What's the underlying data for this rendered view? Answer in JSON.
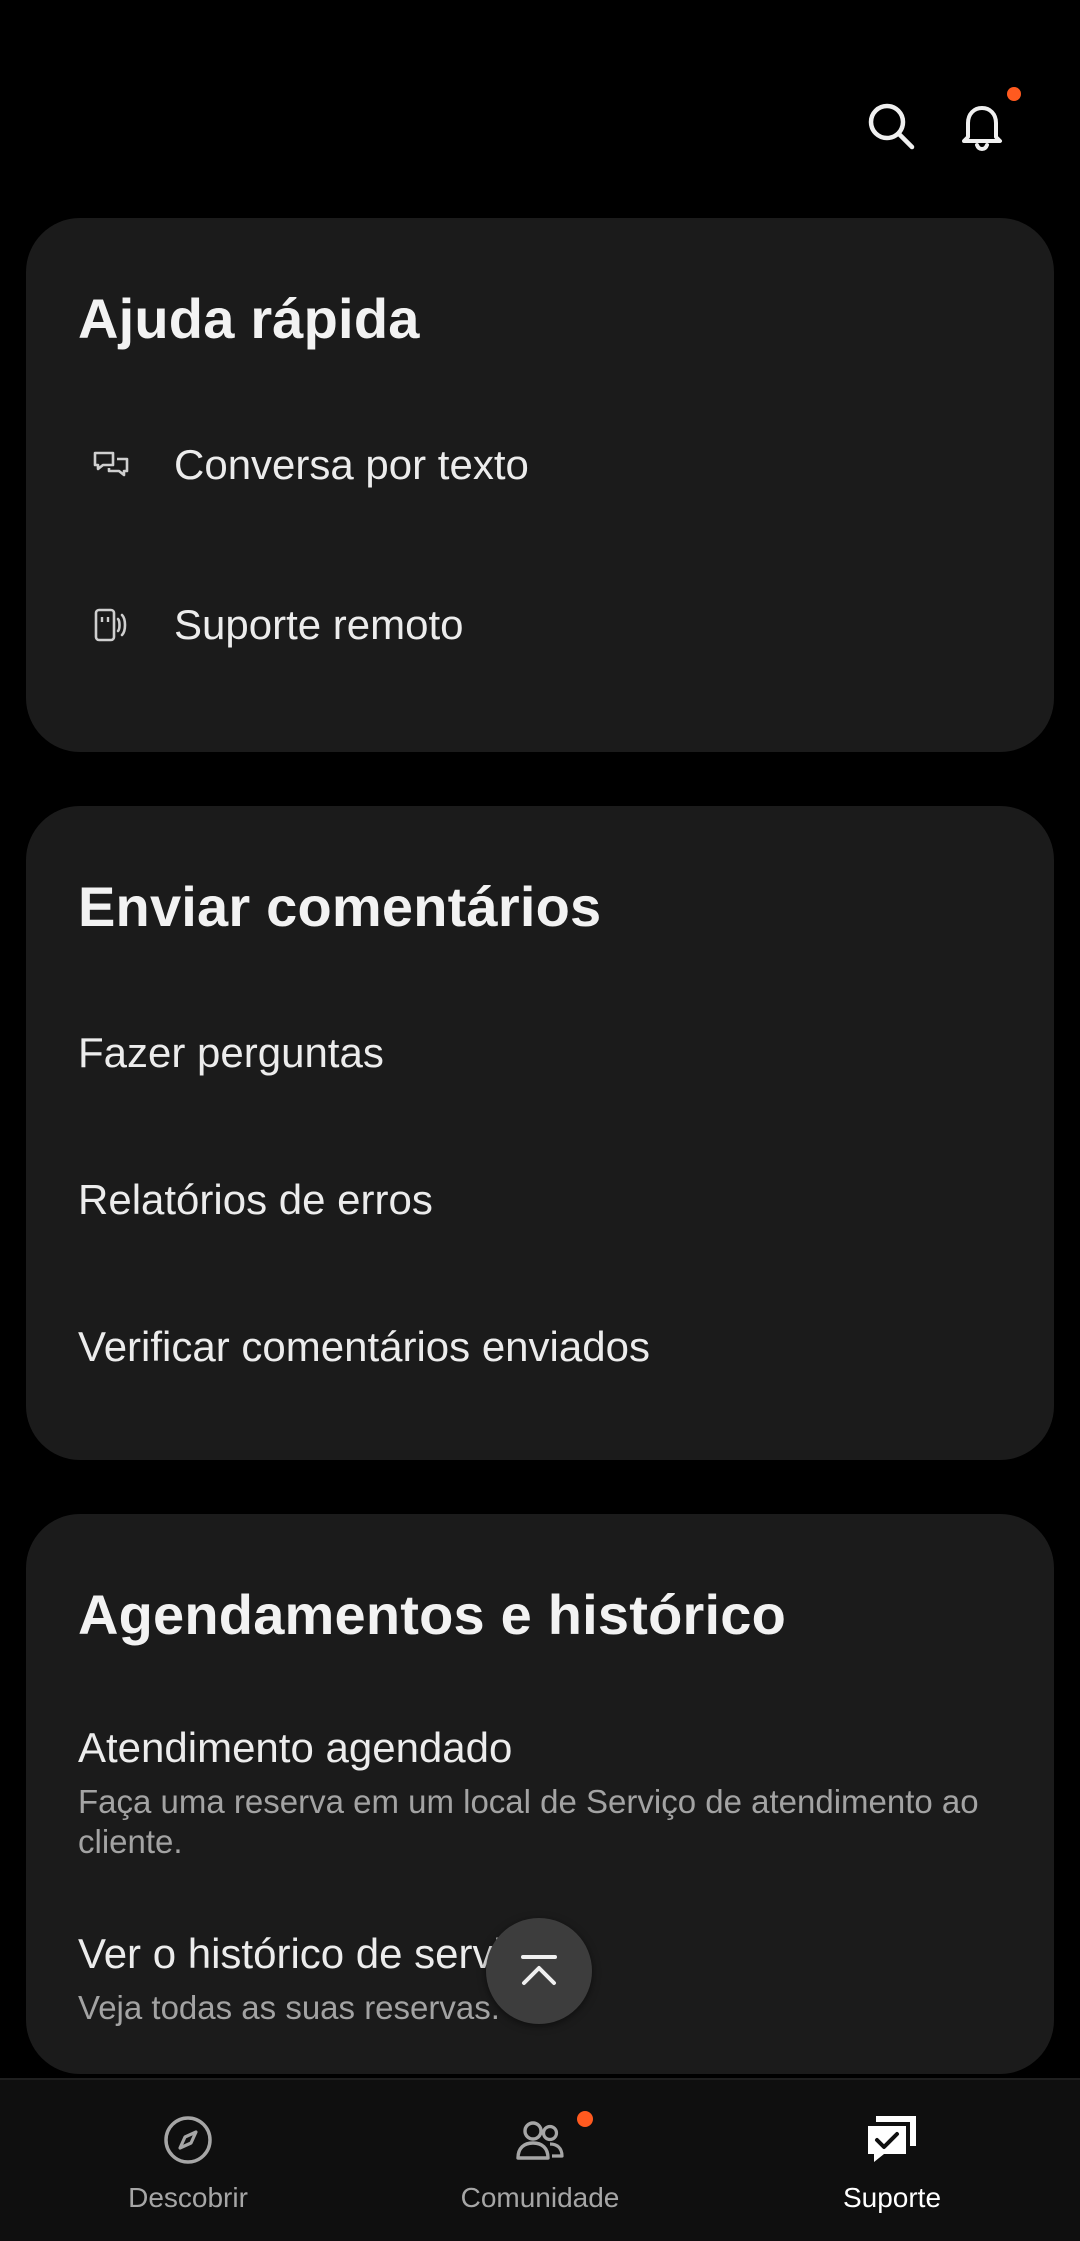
{
  "header": {
    "search_icon": "search-icon",
    "notification_icon": "bell-icon",
    "notification_badge_color": "#ff5a1f"
  },
  "quick_help": {
    "title": "Ajuda rápida",
    "items": [
      {
        "label": "Conversa por texto",
        "icon": "chat-bubbles-icon"
      },
      {
        "label": "Suporte remoto",
        "icon": "remote-device-icon"
      }
    ]
  },
  "feedback": {
    "title": "Enviar comentários",
    "items": [
      {
        "label": "Fazer perguntas"
      },
      {
        "label": "Relatórios de erros"
      },
      {
        "label": "Verificar comentários enviados"
      }
    ]
  },
  "appointments": {
    "title": "Agendamentos e histórico",
    "items": [
      {
        "label": "Atendimento agendado",
        "description": "Faça uma reserva em um local de Serviço de atendimento ao cliente."
      },
      {
        "label": "Ver o histórico de serviços",
        "description": "Veja todas as suas reservas."
      }
    ]
  },
  "fab": {
    "icon": "scroll-to-top-icon"
  },
  "bottom_nav": {
    "items": [
      {
        "label": "Descobrir",
        "icon": "compass-icon",
        "active": false
      },
      {
        "label": "Comunidade",
        "icon": "people-icon",
        "active": false,
        "badge": true
      },
      {
        "label": "Suporte",
        "icon": "support-chat-icon",
        "active": true
      }
    ]
  },
  "colors": {
    "background": "#000000",
    "card": "#1b1b1b",
    "accent_badge": "#ff5a1f",
    "text_primary": "#ececec",
    "text_secondary": "#a3a3a3"
  }
}
